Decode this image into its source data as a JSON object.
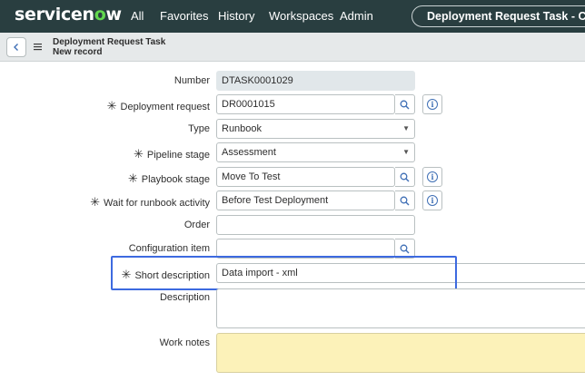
{
  "nav": {
    "logo_a": "servicen",
    "logo_o": "o",
    "logo_b": "w",
    "links": [
      "All",
      "Favorites",
      "History",
      "Workspaces",
      "Admin"
    ],
    "record_pill": "Deployment Request Task - Create"
  },
  "form": {
    "title_line1": "Deployment Request Task",
    "title_line2": "New record",
    "back_icon": "chevron-left-icon",
    "menu_icon": "hamburger-icon"
  },
  "fields": {
    "number": {
      "label": "Number",
      "value": "DTASK0001029"
    },
    "deployment_request": {
      "label": "Deployment request",
      "value": "DR0001015"
    },
    "type": {
      "label": "Type",
      "value": "Runbook"
    },
    "pipeline_stage": {
      "label": "Pipeline stage",
      "value": "Assessment"
    },
    "playbook_stage": {
      "label": "Playbook stage",
      "value": "Move To Test"
    },
    "wait_for_runbook": {
      "label": "Wait for runbook activity",
      "value": "Before Test Deployment"
    },
    "order": {
      "label": "Order",
      "value": ""
    },
    "configuration_item": {
      "label": "Configuration item",
      "value": ""
    },
    "short_description": {
      "label": "Short description",
      "value": "Data import - xml"
    },
    "description": {
      "label": "Description",
      "value": ""
    },
    "work_notes": {
      "label": "Work notes",
      "value": ""
    }
  },
  "required_marker": "✳",
  "colors": {
    "nav_bg": "#293e40",
    "logo_accent": "#62d84e",
    "link_blue": "#3f6fb5",
    "highlight": "#3d6ae0",
    "journal_bg": "#fcf2b9"
  }
}
